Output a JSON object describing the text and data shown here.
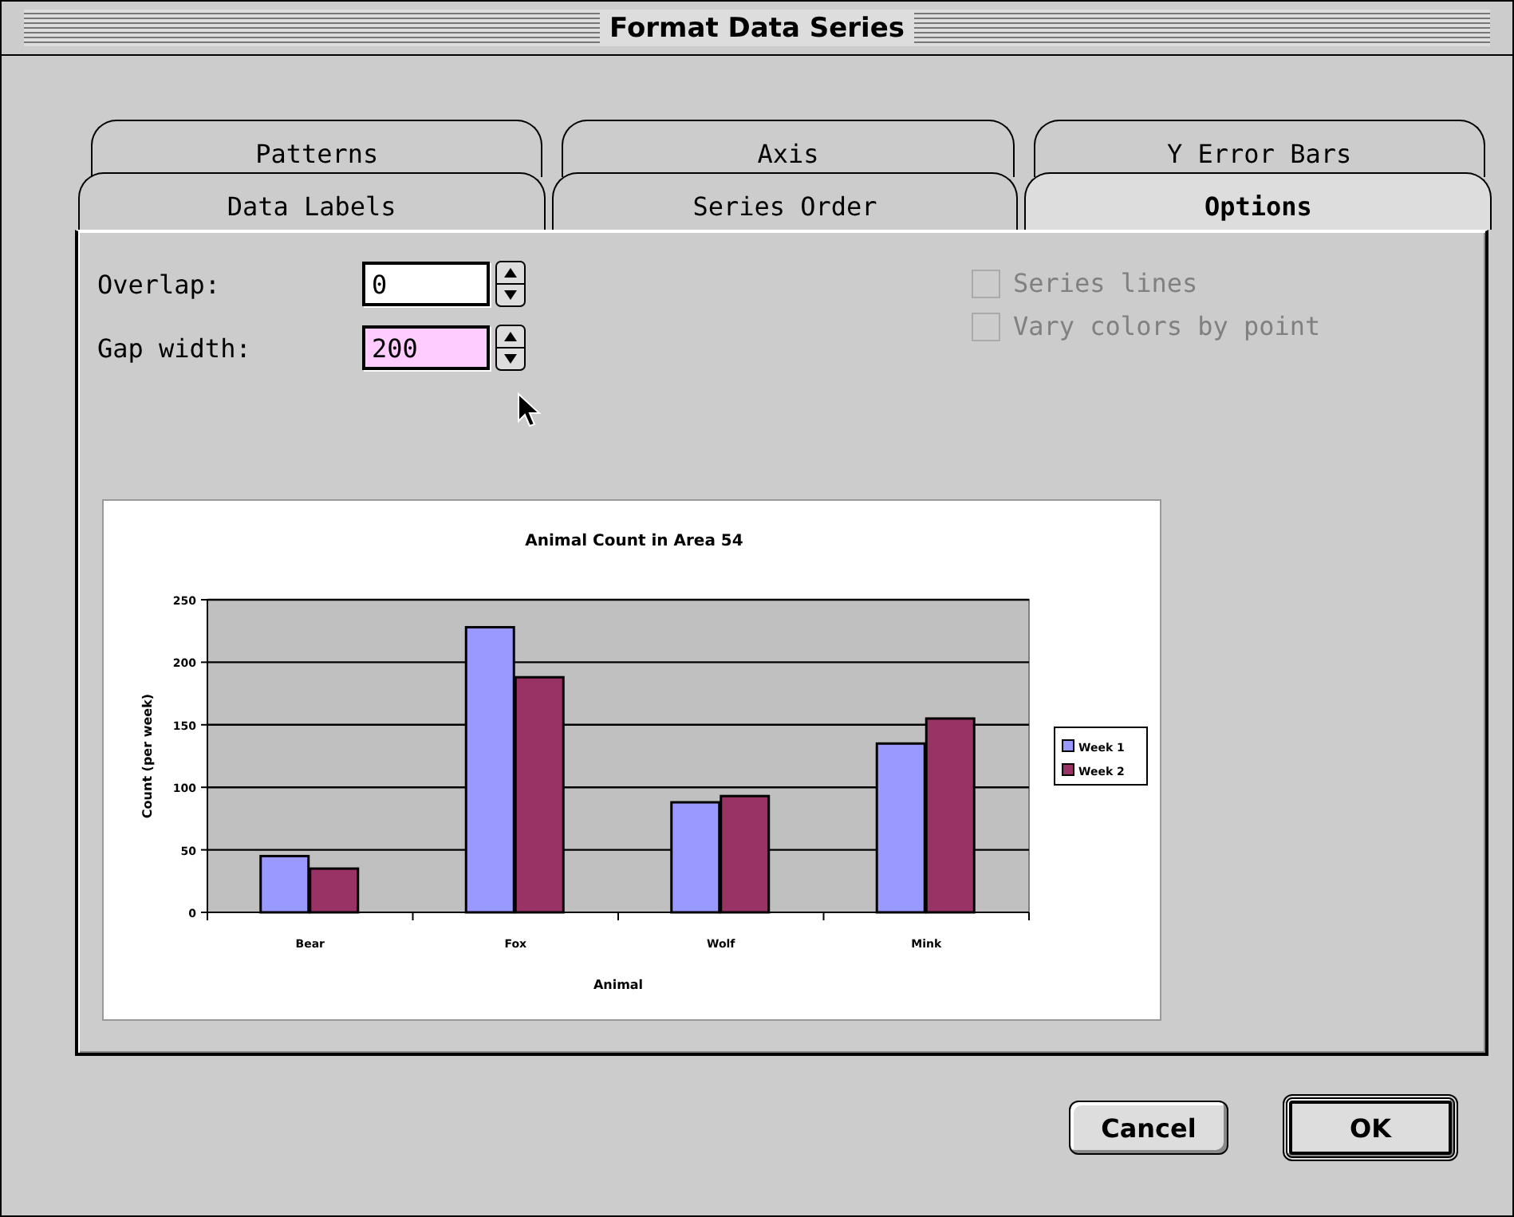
{
  "window": {
    "title": "Format Data Series"
  },
  "tab_rows": [
    {
      "tabs": [
        {
          "label": "Patterns",
          "selected": false
        },
        {
          "label": "Axis",
          "selected": false
        },
        {
          "label": "Y Error Bars",
          "selected": false
        }
      ]
    },
    {
      "tabs": [
        {
          "label": "Data Labels",
          "selected": false
        },
        {
          "label": "Series Order",
          "selected": false
        },
        {
          "label": "Options",
          "selected": true
        }
      ]
    }
  ],
  "fields": [
    {
      "label": "Overlap:",
      "value": "0",
      "focused": false
    },
    {
      "label": "Gap width:",
      "value": "200",
      "focused": true
    }
  ],
  "checkboxes": [
    {
      "label": "Series lines",
      "checked": false,
      "disabled": true
    },
    {
      "label": "Vary colors by point",
      "checked": false,
      "disabled": true
    }
  ],
  "preview": {
    "chart_data": {
      "type": "bar",
      "title": "Animal Count in Area 54",
      "xlabel": "Animal",
      "ylabel": "Count (per week)",
      "categories": [
        "Bear",
        "Fox",
        "Wolf",
        "Mink"
      ],
      "series": [
        {
          "name": "Week 1",
          "color": "#9999ff",
          "values": [
            45,
            228,
            88,
            135
          ]
        },
        {
          "name": "Week 2",
          "color": "#993366",
          "values": [
            35,
            188,
            93,
            155
          ]
        }
      ],
      "grid": true,
      "legend": "right",
      "ylim": [
        0,
        250
      ],
      "yticks": [
        0,
        50,
        100,
        150,
        200,
        250
      ]
    }
  },
  "buttons": [
    {
      "label": "Cancel",
      "default": false
    },
    {
      "label": "OK",
      "default": true
    }
  ]
}
